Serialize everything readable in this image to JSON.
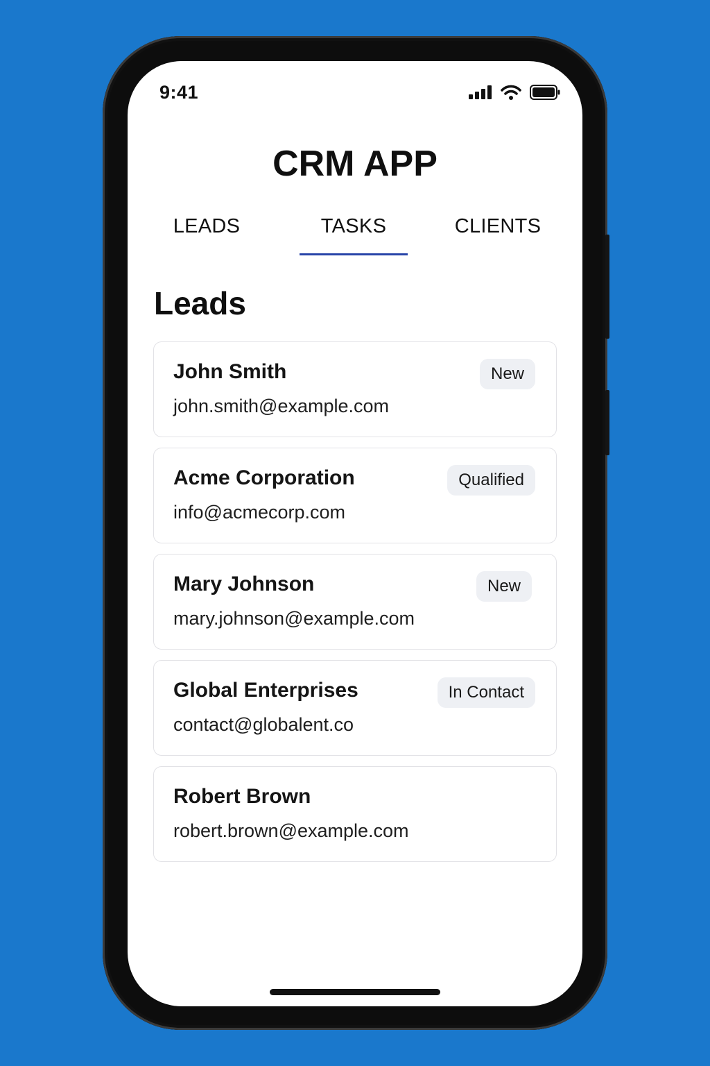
{
  "status_bar": {
    "time": "9:41",
    "icons": [
      "signal-icon",
      "wifi-icon",
      "battery-icon"
    ]
  },
  "app": {
    "title": "CRM APP"
  },
  "tabs": [
    {
      "label": "LEADS",
      "active": false
    },
    {
      "label": "TASKS",
      "active": true
    },
    {
      "label": "CLIENTS",
      "active": false
    }
  ],
  "section": {
    "title": "Leads"
  },
  "leads": [
    {
      "name": "John Smith",
      "email": "john.smith@example.com",
      "status": "New"
    },
    {
      "name": "Acme Corporation",
      "email": "info@acmecorp.com",
      "status": "Qualified"
    },
    {
      "name": "Mary Johnson",
      "email": "mary.johnson@example.com",
      "status": "New"
    },
    {
      "name": "Global Enterprises",
      "email": "contact@globalent.co",
      "status": "In Contact"
    },
    {
      "name": "Robert Brown",
      "email": "robert.brown@example.com",
      "status": ""
    }
  ],
  "colors": {
    "background": "#1a78cc",
    "accent": "#2743a8",
    "badge_bg": "#eef0f4"
  }
}
